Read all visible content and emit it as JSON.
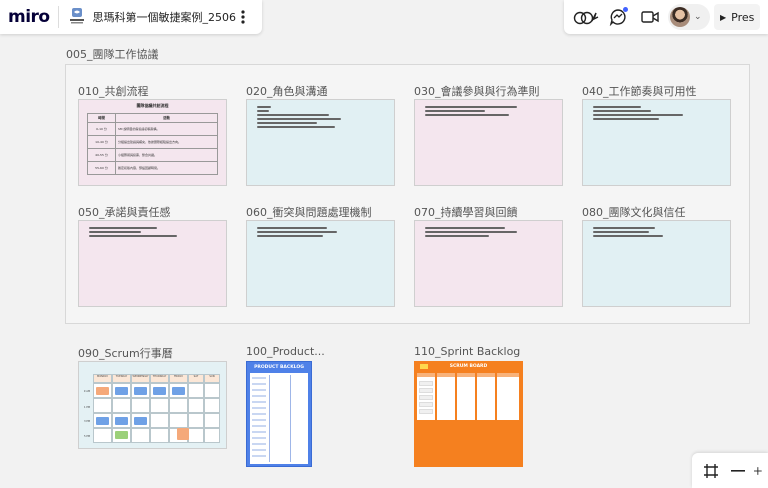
{
  "app": {
    "logo": "miro",
    "board_name": "思瑪科第一個敏捷案例_2506",
    "more_icon": "kebab-icon"
  },
  "toolbar": {
    "reactions_icon": "reactions-icon",
    "comments_icon": "chat-icon",
    "video_icon": "video-camera-icon",
    "present_label": "Pres"
  },
  "section": {
    "title": "005_團隊工作協議"
  },
  "frames": [
    {
      "label": "010_共創流程",
      "color": "pink"
    },
    {
      "label": "020_角色與溝通",
      "color": "teal"
    },
    {
      "label": "030_會議參與與行為準則",
      "color": "pink"
    },
    {
      "label": "040_工作節奏與可用性",
      "color": "teal"
    },
    {
      "label": "050_承諾與責任感",
      "color": "pink"
    },
    {
      "label": "060_衝突與問題處理機制",
      "color": "teal"
    },
    {
      "label": "070_持續學習與回饋",
      "color": "pink"
    },
    {
      "label": "080_團隊文化與信任",
      "color": "teal"
    }
  ],
  "process_card": {
    "title": "團隊協議共創流程",
    "col_time": "時間",
    "col_activity": "活動",
    "rows": [
      {
        "time": "0-10 分",
        "activity": "SM 說明目的與協議初稿架構。"
      },
      {
        "time": "10-40 分",
        "activity": "分組提出建議與補充，依據實際經驗提出方向。"
      },
      {
        "time": "40-55 分",
        "activity": "小組匯報與投票，整合共識。"
      },
      {
        "time": "55-60 分",
        "activity": "確定初版內容，預設回顧時間。"
      }
    ]
  },
  "boards": [
    {
      "label": "090_Scrum行事曆"
    },
    {
      "label": "100_Product..."
    },
    {
      "label": "110_Sprint Backlog"
    }
  ],
  "calendar": {
    "days": [
      "MONDAY",
      "TUESDAY",
      "WEDNESDAY",
      "THURSDAY",
      "FRIDAY",
      "SAT",
      "SUN"
    ],
    "rows": [
      "9 AM",
      "1 PM",
      "3 PM",
      "5 PM"
    ]
  },
  "product_backlog": {
    "title": "PRODUCT BACKLOG"
  },
  "scrum_board": {
    "title": "SCRUM BOARD"
  },
  "zoom": {
    "frame_icon": "frame-icon",
    "zoom_out_icon": "minus-icon"
  },
  "colors": {
    "pink_card": "#f4e6ee",
    "teal_card": "#e1f0f3",
    "backlog_blue": "#4f81e8",
    "scrum_orange": "#f5801f",
    "accent": "#4262ff"
  }
}
